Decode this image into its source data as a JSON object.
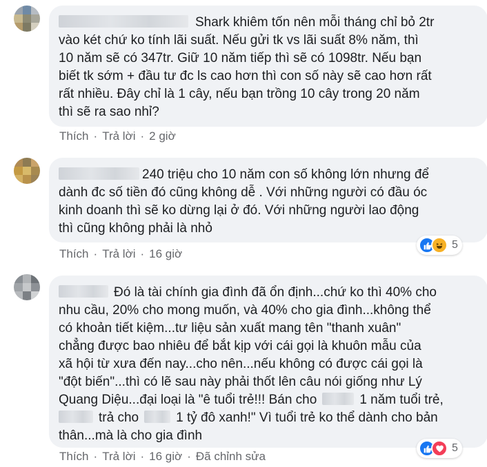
{
  "colors": {
    "bubble": "#f0f2f5",
    "like": "#1877f2",
    "haha": "#f7b125",
    "love": "#f33e58",
    "meta_text": "#65676b"
  },
  "comments": [
    {
      "author_redacted": true,
      "lines": [
        "Shark khiêm tốn nên mỗi tháng chỉ bỏ 2tr",
        "vào két chứ ko tính lãi suất. Nếu gửi tk vs lãi suất 8% năm, thì",
        "10 năm sẽ có 347tr. Giữ 10 năm tiếp thì sẽ có 1098tr. Nếu bạn",
        "biết tk sớm + đầu tư đc ls cao hơn thì con số này sẽ cao hơn rất",
        "rất nhiều. Đây chỉ là 1 cây, nếu bạn trồng 10 cây trong 20 năm",
        "thì sẽ ra sao nhỉ?"
      ],
      "like_label": "Thích",
      "reply_label": "Trả lời",
      "time": "2 giờ"
    },
    {
      "author_redacted": true,
      "lines": [
        "240 triệu cho 10 năm con số không lớn nhưng để",
        "dành đc số tiền đó cũng không dễ . Với những người có đầu óc",
        "kinh doanh thì sẽ ko dừng lại ở đó. Với những người lao động",
        "thì cũng không phải là nhỏ"
      ],
      "like_label": "Thích",
      "reply_label": "Trả lời",
      "time": "16 giờ",
      "reactions": {
        "icons": [
          "like-icon",
          "haha-icon"
        ],
        "count": "5"
      }
    },
    {
      "author_redacted": true,
      "lines": [
        "Đó là tài chính gia đình đã ổn định...chứ ko thì 40% cho",
        "nhu cầu, 20% cho mong muốn, và 40% cho gia đình...không thể",
        "có khoản tiết kiệm...tư liệu sản xuất mang tên \"thanh xuân\"",
        "chẳng được bao nhiêu để bắt kịp với cái gọi là khuôn mẫu của",
        "xã hội từ xưa đến nay...cho nên...nếu không có được cái gọi là",
        "\"đột biến\"...thì có lẽ sau này phải thốt lên câu nói giống như Lý",
        "Quang Diệu...đại loại là \"ê tuổi trẻ!!! Bán cho",
        "1 năm tuổi trẻ,",
        "trả cho",
        "1 tỷ đô xanh!\" Vì tuổi trẻ ko thể dành cho bản",
        "thân...mà là cho gia đình"
      ],
      "like_label": "Thích",
      "reply_label": "Trả lời",
      "time": "16 giờ",
      "edited_label": "Đã chỉnh sửa",
      "reactions": {
        "icons": [
          "like-icon",
          "love-icon"
        ],
        "count": "5"
      }
    }
  ]
}
